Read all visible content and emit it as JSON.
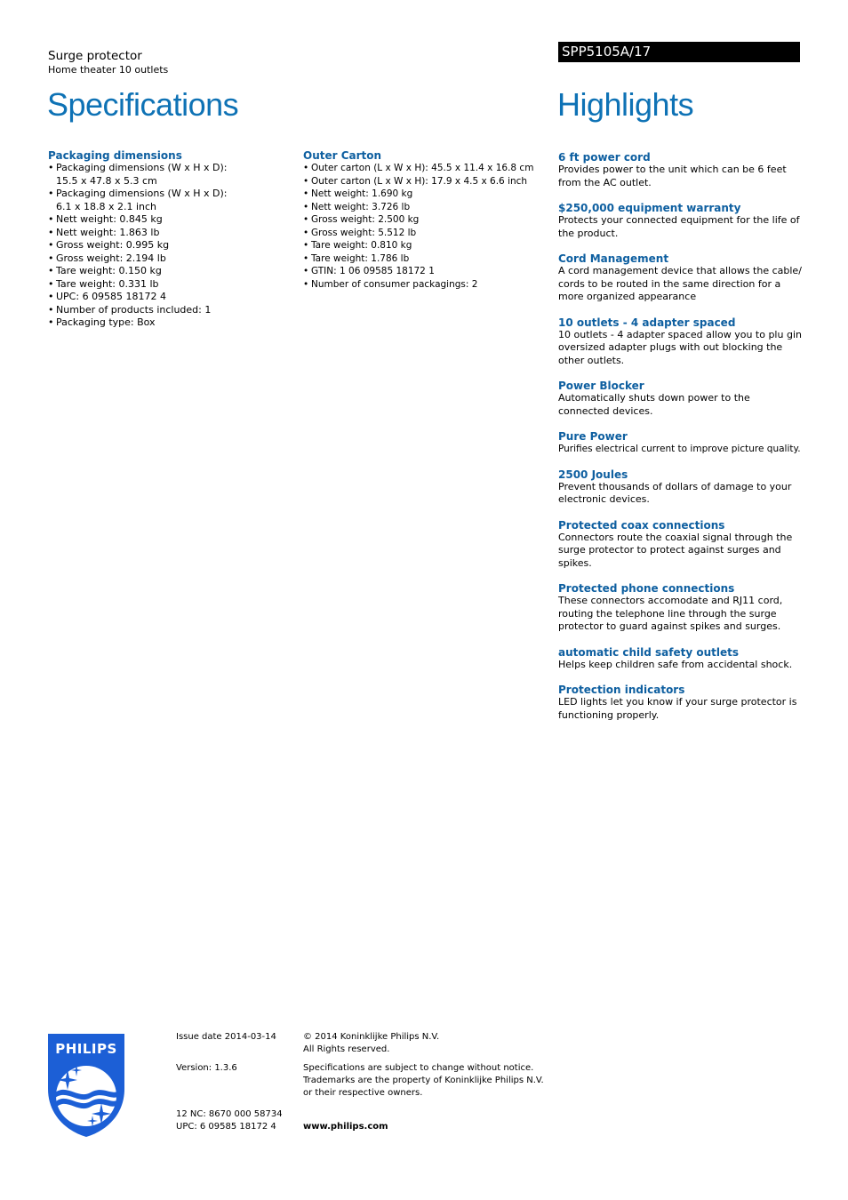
{
  "header": {
    "product_name": "Surge protector",
    "product_subtitle": "Home theater 10 outlets",
    "model_number": "SPP5105A/17",
    "specifications_title": "Specifications",
    "highlights_title": "Highlights"
  },
  "colors": {
    "accent_blue": "#0e72b5",
    "heading_blue": "#0e5fa0",
    "model_bar": "#000000",
    "logo_blue": "#1c5fd6"
  },
  "specifications": {
    "packaging_dimensions": {
      "heading": "Packaging dimensions",
      "items": [
        "Packaging dimensions (W x H x D): 15.5 x 47.8 x 5.3 cm",
        "Packaging dimensions (W x H x D): 6.1 x 18.8 x 2.1 inch",
        "Nett weight: 0.845 kg",
        "Nett weight: 1.863 lb",
        "Gross weight: 0.995 kg",
        "Gross weight: 2.194 lb",
        "Tare weight: 0.150 kg",
        "Tare weight: 0.331 lb",
        "UPC: 6 09585 18172 4",
        "Number of products included: 1",
        "Packaging type: Box"
      ]
    },
    "outer_carton": {
      "heading": "Outer Carton",
      "items": [
        "Outer carton (L x W x H): 45.5 x 11.4 x 16.8 cm",
        "Outer carton (L x W x H): 17.9 x 4.5 x 6.6 inch",
        "Nett weight: 1.690 kg",
        "Nett weight: 3.726 lb",
        "Gross weight: 2.500 kg",
        "Gross weight: 5.512 lb",
        "Tare weight: 0.810 kg",
        "Tare weight: 1.786 lb",
        "GTIN: 1 06 09585 18172 1",
        "Number of consumer packagings: 2"
      ]
    }
  },
  "highlights": [
    {
      "title": "6 ft power cord",
      "text": "Provides power to the unit which can be 6 feet from the AC outlet."
    },
    {
      "title": "$250,000 equipment warranty",
      "text": "Protects your connected equipment for the life of the product."
    },
    {
      "title": "Cord Management",
      "text": "A cord management device that allows the cable/ cords to be routed in the same direction for a more organized appearance"
    },
    {
      "title": "10 outlets - 4 adapter spaced",
      "text": "10 outlets - 4 adapter spaced allow you to plu gin oversized adapter plugs with out blocking the other outlets."
    },
    {
      "title": "Power Blocker",
      "text": "Automatically shuts down power to the connected devices."
    },
    {
      "title": "Pure Power",
      "text": "Purifies electrical current to improve picture quality."
    },
    {
      "title": "2500 Joules",
      "text": "Prevent thousands of dollars of damage to your electronic devices."
    },
    {
      "title": "Protected coax connections",
      "text": "Connectors route the coaxial signal through the surge protector to protect against surges and spikes."
    },
    {
      "title": "Protected phone connections",
      "text": "These connectors accomodate and RJ11 cord, routing the telephone line through the surge protector to guard against spikes and surges."
    },
    {
      "title": "automatic child safety outlets",
      "text": "Helps keep children safe from accidental shock."
    },
    {
      "title": "Protection indicators",
      "text": "LED lights let you know if your surge protector is functioning properly."
    }
  ],
  "footer": {
    "logo_text": "PHILIPS",
    "issue_date": "Issue date 2014-03-14",
    "version": "Version: 1.3.6",
    "nc": "12 NC: 8670 000 58734",
    "upc": "UPC: 6 09585 18172 4",
    "copyright_line1": "© 2014 Koninklijke Philips N.V.",
    "copyright_line2": "All Rights reserved.",
    "disclaimer_line1": "Specifications are subject to change without notice.",
    "disclaimer_line2": "Trademarks are the property of Koninklijke Philips N.V.",
    "disclaimer_line3": "or their respective owners.",
    "website": "www.philips.com"
  }
}
